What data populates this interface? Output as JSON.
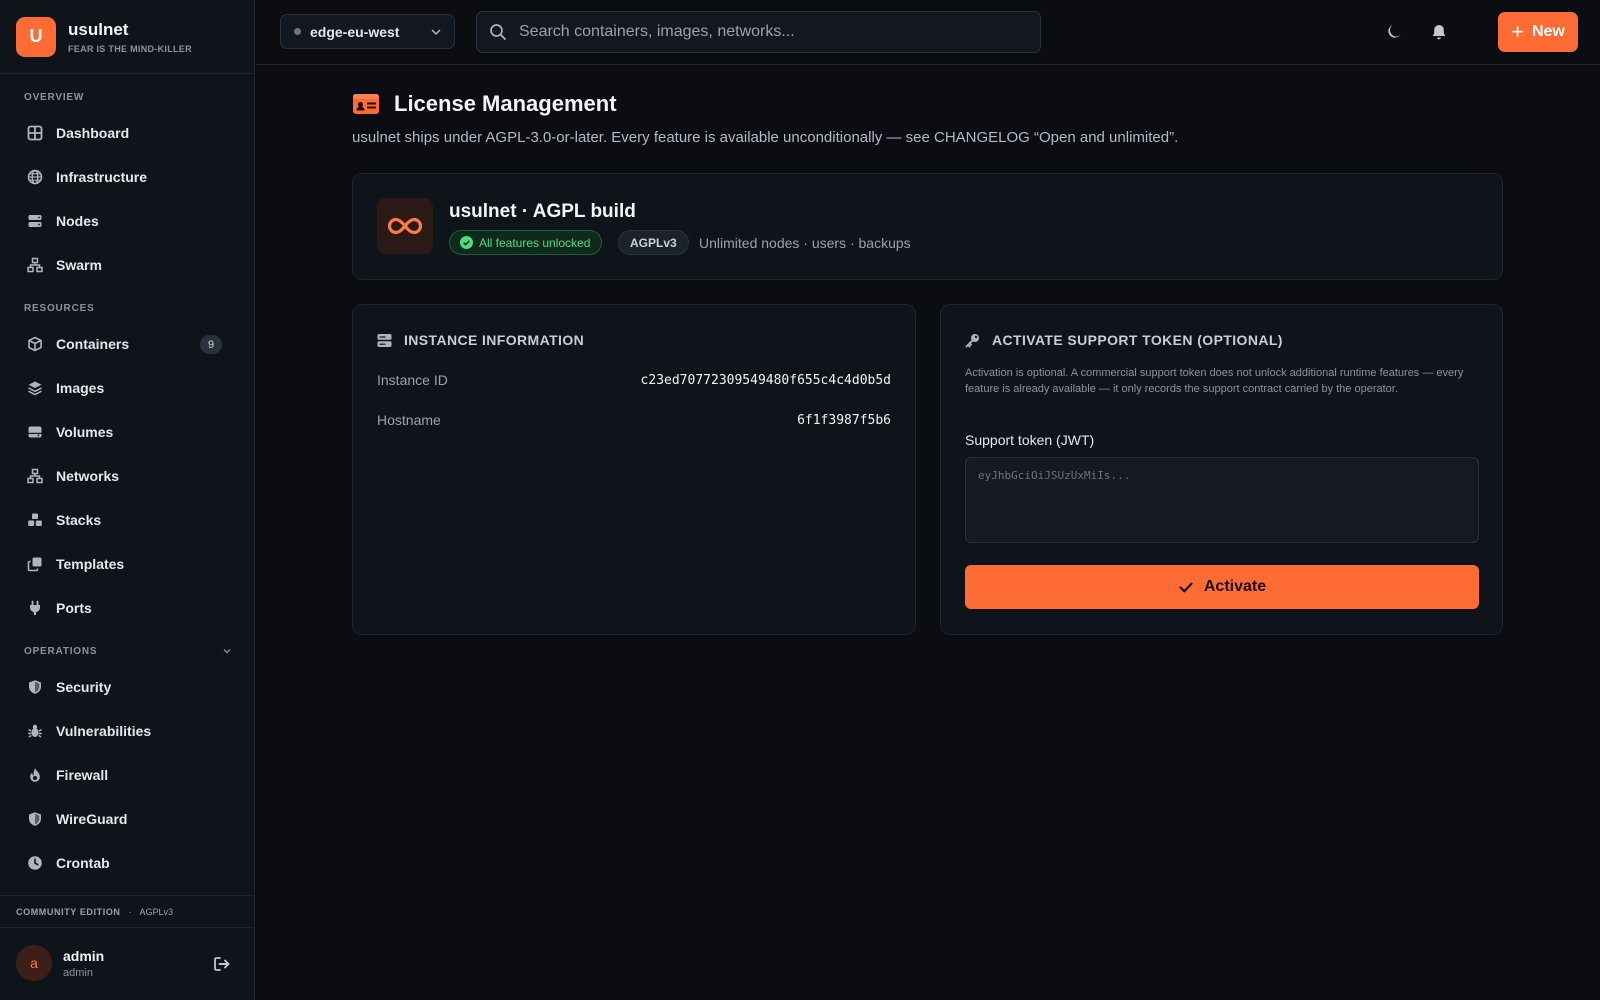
{
  "brand": {
    "logo_letter": "U",
    "name": "usulnet",
    "tagline": "FEAR IS THE MIND-KILLER"
  },
  "sidebar": {
    "sections": {
      "overview": "OVERVIEW",
      "resources": "RESOURCES",
      "operations": "OPERATIONS"
    },
    "overview_items": [
      {
        "label": "Dashboard",
        "icon": "grid-icon"
      },
      {
        "label": "Infrastructure",
        "icon": "globe-icon"
      },
      {
        "label": "Nodes",
        "icon": "server-icon"
      },
      {
        "label": "Swarm",
        "icon": "network-icon"
      }
    ],
    "resource_items": [
      {
        "label": "Containers",
        "icon": "cube-icon",
        "badge": "9"
      },
      {
        "label": "Images",
        "icon": "layers-icon"
      },
      {
        "label": "Volumes",
        "icon": "hdd-icon"
      },
      {
        "label": "Networks",
        "icon": "network-icon"
      },
      {
        "label": "Stacks",
        "icon": "cubes-icon"
      },
      {
        "label": "Templates",
        "icon": "clone-icon"
      },
      {
        "label": "Ports",
        "icon": "plug-icon"
      }
    ],
    "operation_items": [
      {
        "label": "Security",
        "icon": "shield-icon"
      },
      {
        "label": "Vulnerabilities",
        "icon": "bug-icon"
      },
      {
        "label": "Firewall",
        "icon": "fire-icon"
      },
      {
        "label": "WireGuard",
        "icon": "shield-icon"
      },
      {
        "label": "Crontab",
        "icon": "clock-icon"
      }
    ],
    "footer": {
      "edition": "COMMUNITY EDITION",
      "separator": "·",
      "license": "AGPLv3"
    },
    "user": {
      "initial": "a",
      "name": "admin",
      "role": "admin"
    }
  },
  "topbar": {
    "environment": "edge-eu-west",
    "search_placeholder": "Search containers, images, networks...",
    "new_label": "New"
  },
  "page": {
    "title": "License Management",
    "subtitle": "usulnet ships under AGPL-3.0-or-later. Every feature is available unconditionally — see CHANGELOG “Open and unlimited”."
  },
  "build": {
    "name": "usulnet · AGPL build",
    "status": "All features unlocked",
    "license": "AGPLv3",
    "capabilities": "Unlimited nodes · users · backups"
  },
  "instance": {
    "heading": "INSTANCE INFORMATION",
    "rows": [
      {
        "label": "Instance ID",
        "value": "c23ed70772309549480f655c4c4d0b5d"
      },
      {
        "label": "Hostname",
        "value": "6f1f3987f5b6"
      }
    ]
  },
  "activation": {
    "heading": "ACTIVATE SUPPORT TOKEN (OPTIONAL)",
    "help": "Activation is optional. A commercial support token does not unlock additional runtime features — every feature is already available — it only records the support contract carried by the operator.",
    "field_label": "Support token (JWT)",
    "token_placeholder": "eyJhbGciOiJSUzUxMiIs...",
    "button": "Activate"
  },
  "colors": {
    "accent": "#ff6b35",
    "success": "#4ade80",
    "background": "#0b0d12",
    "surface": "#0f141b"
  }
}
